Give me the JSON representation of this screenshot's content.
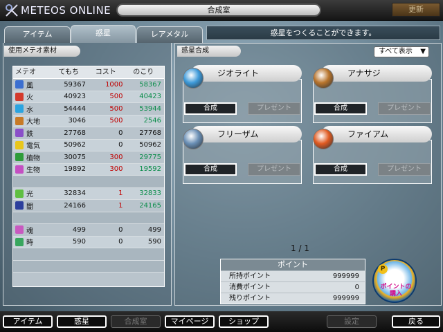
{
  "app": {
    "logo_text": "METEOS ONLINE",
    "screen_title": "合成室",
    "update_label": "更新"
  },
  "tabs": [
    {
      "label": "アイテム",
      "active": false
    },
    {
      "label": "惑星",
      "active": true
    },
    {
      "label": "レアメタル",
      "active": false
    }
  ],
  "message": "惑星をつくることができます。",
  "left": {
    "section_label": "使用メテオ素材",
    "columns": [
      "メテオ",
      "てもち",
      "コスト",
      "のこり"
    ],
    "rows": [
      {
        "icon": "wind-icon",
        "color": "#3b6fd0",
        "name": "風",
        "have": "59367",
        "cost": "1000",
        "left": "58367",
        "cost_red": true,
        "left_green": true
      },
      {
        "icon": "fire-icon",
        "color": "#d43a2c",
        "name": "火",
        "have": "40923",
        "cost": "500",
        "left": "40423",
        "cost_red": true,
        "left_green": true
      },
      {
        "icon": "water-icon",
        "color": "#2aa4e0",
        "name": "水",
        "have": "54444",
        "cost": "500",
        "left": "53944",
        "cost_red": true,
        "left_green": true
      },
      {
        "icon": "earth-icon",
        "color": "#c77a26",
        "name": "大地",
        "have": "3046",
        "cost": "500",
        "left": "2546",
        "cost_red": true,
        "left_green": true
      },
      {
        "icon": "iron-icon",
        "color": "#8a4fc9",
        "name": "鉄",
        "have": "27768",
        "cost": "0",
        "left": "27768",
        "cost_red": false,
        "left_green": false
      },
      {
        "icon": "electric-icon",
        "color": "#e8c61c",
        "name": "電気",
        "have": "50962",
        "cost": "0",
        "left": "50962",
        "cost_red": false,
        "left_green": false
      },
      {
        "icon": "plant-icon",
        "color": "#2e9c3a",
        "name": "植物",
        "have": "30075",
        "cost": "300",
        "left": "29775",
        "cost_red": true,
        "left_green": true
      },
      {
        "icon": "creature-icon",
        "color": "#c44fc2",
        "name": "生物",
        "have": "19892",
        "cost": "300",
        "left": "19592",
        "cost_red": true,
        "left_green": true
      },
      {
        "blank": true
      },
      {
        "icon": "light-icon",
        "color": "#5fbf42",
        "name": "光",
        "have": "32834",
        "cost": "1",
        "left": "32833",
        "cost_red": true,
        "left_green": true
      },
      {
        "icon": "dark-icon",
        "color": "#2c3f9c",
        "name": "闇",
        "have": "24166",
        "cost": "1",
        "left": "24165",
        "cost_red": true,
        "left_green": true
      },
      {
        "blank": true
      },
      {
        "icon": "soul-icon",
        "color": "#c85ac0",
        "name": "魂",
        "have": "499",
        "cost": "0",
        "left": "499",
        "cost_red": false,
        "left_green": false
      },
      {
        "icon": "time-icon",
        "color": "#38a65e",
        "name": "時",
        "have": "590",
        "cost": "0",
        "left": "590",
        "cost_red": false,
        "left_green": false
      },
      {
        "blank": true
      },
      {
        "blank": true
      }
    ]
  },
  "right": {
    "section_label": "惑星合成",
    "dropdown": "すべて表示",
    "planets": [
      {
        "name": "ジオライト",
        "icon": "geolight-planet-icon",
        "color": "#3d9ad9",
        "action": "合成",
        "present": "プレゼント"
      },
      {
        "name": "アナサジ",
        "icon": "anasaze-planet-icon",
        "color": "#b8742c",
        "action": "合成",
        "present": "プレゼント"
      },
      {
        "name": "フリーザム",
        "icon": "freaze-planet-icon",
        "color": "#6a8fb5",
        "action": "合成",
        "present": "プレゼント"
      },
      {
        "name": "ファイアム",
        "icon": "firim-planet-icon",
        "color": "#e05a20",
        "action": "合成",
        "present": "プレゼント"
      }
    ],
    "page": "1 / 1",
    "points": {
      "title": "ポイント",
      "rows": [
        {
          "label": "所持ポイント",
          "value": "999999"
        },
        {
          "label": "消費ポイント",
          "value": "0"
        },
        {
          "label": "残りポイント",
          "value": "999999"
        }
      ]
    },
    "buy_points": {
      "line1": "ポイントの",
      "line2": "購入"
    }
  },
  "bottom": {
    "items": "アイテム",
    "planets": "惑星",
    "synthesis": "合成室",
    "mypage": "マイページ",
    "shop": "ショップ",
    "settings": "設定",
    "back": "戻る"
  }
}
